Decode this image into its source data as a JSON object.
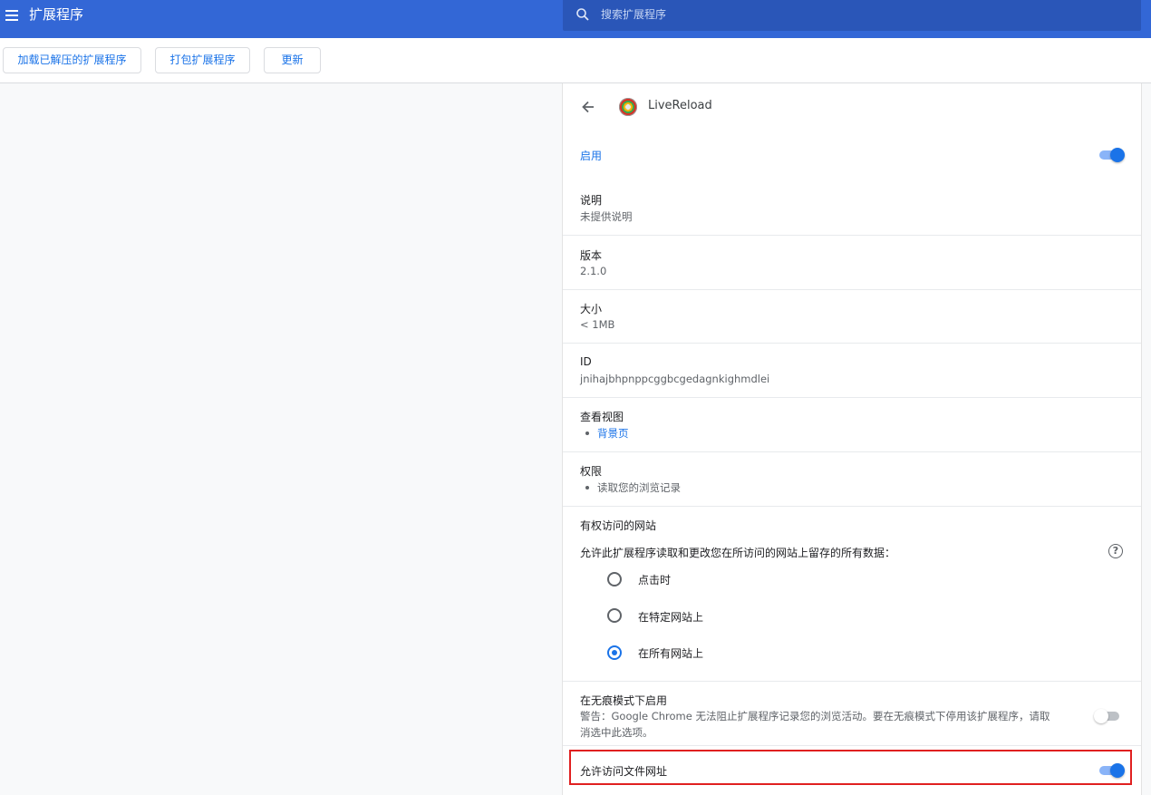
{
  "header": {
    "title": "扩展程序",
    "search_placeholder": "搜索扩展程序"
  },
  "toolbar": {
    "load_unpacked": "加载已解压的扩展程序",
    "pack_extension": "打包扩展程序",
    "update": "更新"
  },
  "detail": {
    "extension_name": "LiveReload",
    "enabled_label": "启用",
    "enabled": true,
    "description_label": "说明",
    "description_value": "未提供说明",
    "version_label": "版本",
    "version_value": "2.1.0",
    "size_label": "大小",
    "size_value": "< 1MB",
    "id_label": "ID",
    "id_value": "jnihajbhpnppcggbcgedagnkighmdlei",
    "views_label": "查看视图",
    "views": [
      "背景页"
    ],
    "permissions_label": "权限",
    "permissions": [
      "读取您的浏览记录"
    ],
    "site_access_label": "有权访问的网站",
    "site_access_desc": "允许此扩展程序读取和更改您在所访问的网站上留存的所有数据：",
    "site_access_options": [
      "点击时",
      "在特定网站上",
      "在所有网站上"
    ],
    "site_access_selected": "在所有网站上",
    "incognito_label": "在无痕模式下启用",
    "incognito_warning_line1": "警告：Google Chrome 无法阻止扩展程序记录您的浏览活动。要在无痕模式下停用该扩展程序，请取",
    "incognito_warning_line2": "消选中此选项。",
    "incognito_enabled": false,
    "file_urls_label": "允许访问文件网址",
    "file_urls_enabled": true
  },
  "icons": [
    "menu-icon",
    "search-icon",
    "back-arrow-icon",
    "extension-icon",
    "help-icon"
  ],
  "colors": {
    "header_bg": "#3367d6",
    "accent": "#1a73e8",
    "highlight_border": "#e02020"
  }
}
